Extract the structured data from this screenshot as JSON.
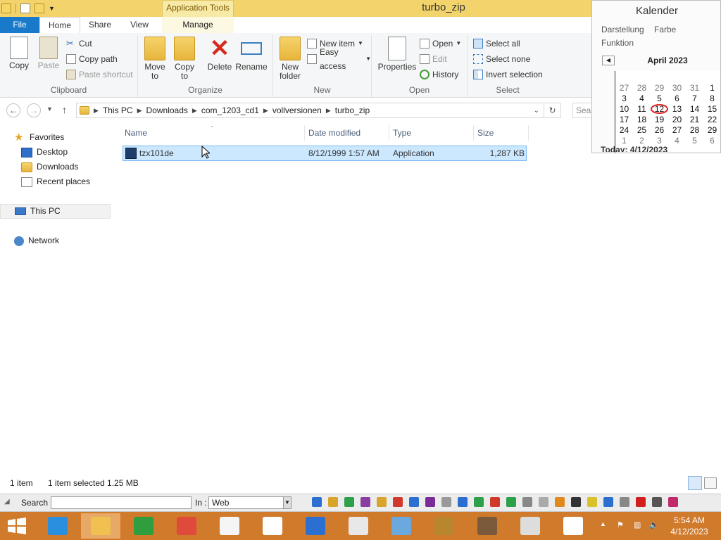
{
  "window": {
    "title": "turbo_zip",
    "context_tab": "Application Tools"
  },
  "tabs": {
    "file": "File",
    "home": "Home",
    "share": "Share",
    "view": "View",
    "manage": "Manage"
  },
  "ribbon": {
    "clipboard": {
      "copy": "Copy",
      "paste": "Paste",
      "cut": "Cut",
      "copy_path": "Copy path",
      "paste_shortcut": "Paste shortcut",
      "label": "Clipboard"
    },
    "organize": {
      "move_to": "Move to",
      "copy_to": "Copy to",
      "delete": "Delete",
      "rename": "Rename",
      "label": "Organize"
    },
    "new": {
      "new_folder": "New folder",
      "new_item": "New item",
      "easy_access": "Easy access",
      "label": "New"
    },
    "open": {
      "properties": "Properties",
      "open": "Open",
      "edit": "Edit",
      "history": "History",
      "label": "Open"
    },
    "select": {
      "select_all": "Select all",
      "select_none": "Select none",
      "invert": "Invert selection",
      "label": "Select"
    }
  },
  "address": {
    "crumbs": [
      "This PC",
      "Downloads",
      "com_1203_cd1",
      "vollversionen",
      "turbo_zip"
    ],
    "search_placeholder": "Sear"
  },
  "nav": {
    "favorites": "Favorites",
    "desktop": "Desktop",
    "downloads": "Downloads",
    "recent": "Recent places",
    "this_pc": "This PC",
    "network": "Network"
  },
  "columns": {
    "name": "Name",
    "date": "Date modified",
    "type": "Type",
    "size": "Size"
  },
  "files": [
    {
      "name": "tzx101de",
      "date": "8/12/1999 1:57 AM",
      "type": "Application",
      "size": "1,287 KB"
    }
  ],
  "status": {
    "count": "1 item",
    "selected": "1 item selected  1.25 MB"
  },
  "calendar": {
    "title": "Kalender",
    "menu": [
      "Darstellung",
      "Farbe",
      "Funktion"
    ],
    "month": "April 2023",
    "weeks": [
      [
        "27",
        "28",
        "29",
        "30",
        "31",
        "1"
      ],
      [
        "3",
        "4",
        "5",
        "6",
        "7",
        "8"
      ],
      [
        "10",
        "11",
        "12",
        "13",
        "14",
        "15"
      ],
      [
        "17",
        "18",
        "19",
        "20",
        "21",
        "22"
      ],
      [
        "24",
        "25",
        "26",
        "27",
        "28",
        "29"
      ],
      [
        "1",
        "2",
        "3",
        "4",
        "5",
        "6"
      ]
    ],
    "today": "12",
    "footer": "Today: 4/12/2023"
  },
  "toolbar": {
    "search_label": "Search :",
    "in_label": "In :",
    "in_value": "Web"
  },
  "clock": {
    "time": "5:54 AM",
    "date": "4/12/2023"
  },
  "colors": {
    "titlebar": "#f3d46c",
    "file_tab": "#1979ca",
    "taskbar": "#d07a2c",
    "selection": "#cce8ff"
  }
}
